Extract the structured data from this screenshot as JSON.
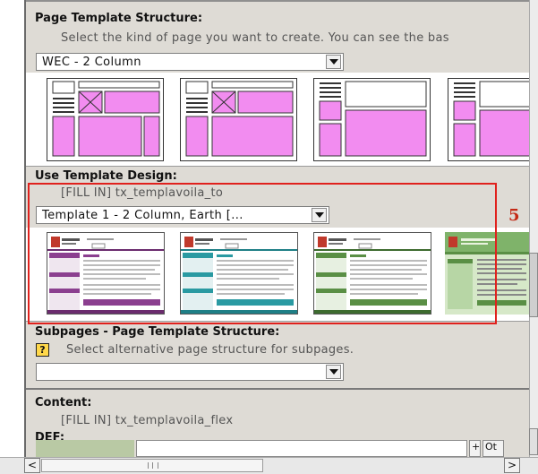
{
  "page_template": {
    "heading": "Page Template Structure:",
    "description": "Select the kind of page you want to create. You can see the bas",
    "selected": "WEC - 2 Column",
    "layouts": [
      "layout-2col-left-nav",
      "layout-2col-right-nav",
      "layout-2col-narrow-left",
      "layout-3col"
    ]
  },
  "template_design": {
    "heading": "Use Template Design:",
    "fill_in": "[FILL IN] tx_templavoila_to",
    "selected": "Template 1 - 2 Column, Earth [...",
    "thumbnails": [
      "purple-theme",
      "teal-theme",
      "green-theme",
      "light-green-theme"
    ],
    "annotation": "5"
  },
  "subpages": {
    "heading": "Subpages - Page Template Structure:",
    "description": "Select alternative page structure for subpages.",
    "selected": ""
  },
  "content": {
    "heading": "Content:",
    "fill_in": "[FILL IN] tx_templavoila_flex",
    "def_label": "DEF:",
    "def_btn1": "+",
    "def_btn2": "Ot"
  },
  "colors": {
    "pink": "#f28cf0",
    "highlight": "#e0211d",
    "section_gray": "#dedbd5"
  }
}
